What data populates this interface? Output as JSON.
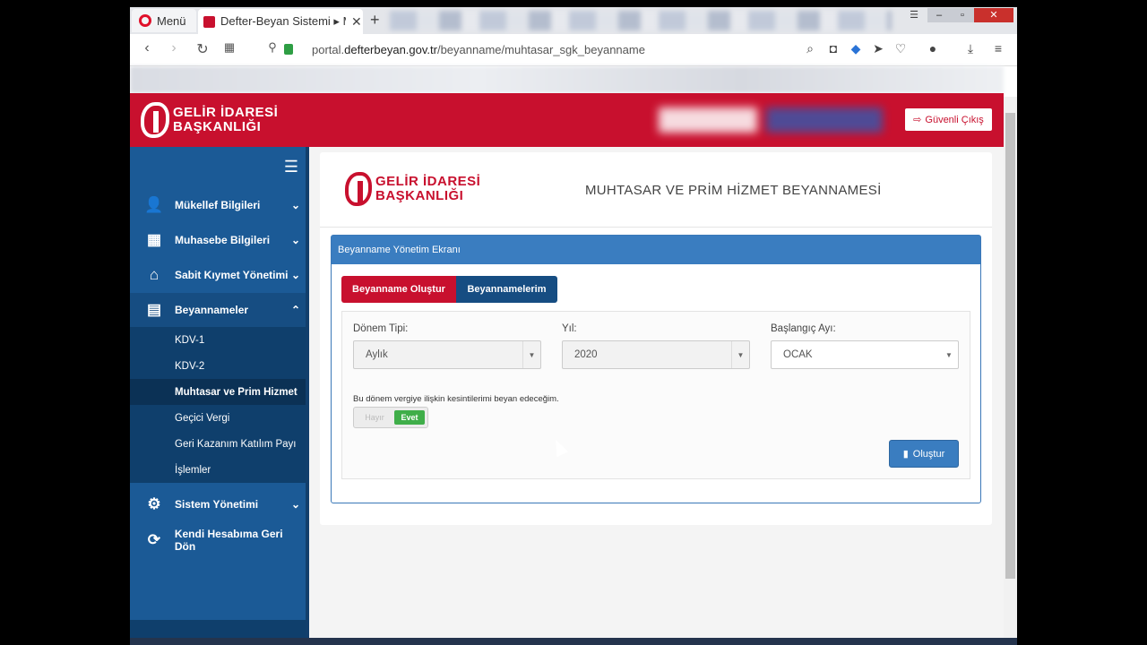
{
  "browser": {
    "menu_label": "Menü",
    "tab_title": "Defter-Beyan Sistemi ▸ Mu",
    "tab_close": "✕",
    "new_tab": "+",
    "url_prefix": "portal.",
    "url_domain": "defterbeyan.gov.tr",
    "url_path": "/beyanname/muhtasar_sgk_beyanname"
  },
  "header": {
    "logo_line1": "GELİR İDARESİ",
    "logo_line2": "BAŞKANLIĞI",
    "logout_label": "Güvenli Çıkış"
  },
  "sidebar": {
    "items": [
      {
        "label": "Mükellef Bilgileri",
        "icon": "user-icon"
      },
      {
        "label": "Muhasebe Bilgileri",
        "icon": "calculator-icon"
      },
      {
        "label": "Sabit Kıymet Yönetimi",
        "icon": "home-icon"
      },
      {
        "label": "Beyannameler",
        "icon": "document-icon"
      }
    ],
    "subitems": [
      "KDV-1",
      "KDV-2",
      "Muhtasar ve Prim Hizmet",
      "Geçici Vergi",
      "Geri Kazanım Katılım Payı",
      "İşlemler"
    ],
    "bottom_items": [
      {
        "label": "Sistem Yönetimi",
        "icon": "gear-icon"
      },
      {
        "label": "Kendi Hesabıma Geri Dön",
        "icon": "refresh-icon"
      }
    ]
  },
  "main": {
    "logo_line1": "GELİR İDARESİ",
    "logo_line2": "BAŞKANLIĞI",
    "title": "MUHTASAR VE PRİM HİZMET BEYANNAMESİ",
    "panel_title": "Beyanname Yönetim Ekranı",
    "tabs": [
      "Beyanname Oluştur",
      "Beyannamelerim"
    ],
    "form": {
      "period_type_label": "Dönem Tipi:",
      "period_type_value": "Aylık",
      "year_label": "Yıl:",
      "year_value": "2020",
      "start_month_label": "Başlangıç Ayı:",
      "start_month_value": "OCAK",
      "note": "Bu dönem vergiye ilişkin kesintilerimi beyan edeceğim.",
      "toggle_off": "Hayır",
      "toggle_on": "Evet",
      "submit_label": "Oluştur"
    }
  },
  "colors": {
    "brand_red": "#c8102e",
    "sidebar_blue": "#1b5a96",
    "panel_blue": "#3a7dc0",
    "toggle_green": "#3fae49"
  }
}
